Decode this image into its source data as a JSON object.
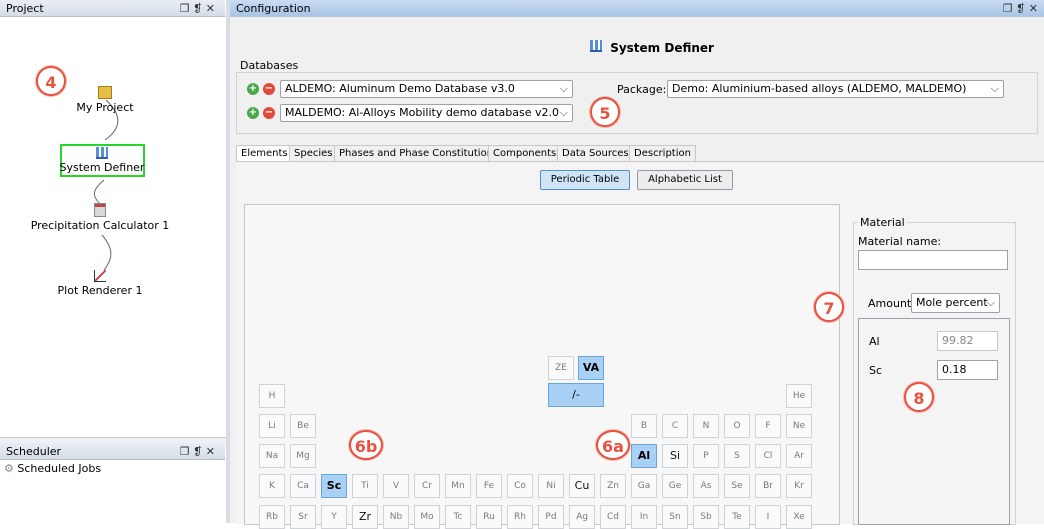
{
  "project_panel": {
    "title": "Project",
    "controls": "❐ ❡ ✕",
    "nodes": [
      {
        "label": "My Project"
      },
      {
        "label": "System Definer"
      },
      {
        "label": "Precipitation Calculator 1"
      },
      {
        "label": "Plot Renderer 1"
      }
    ],
    "badge": "4"
  },
  "scheduler_panel": {
    "title": "Scheduler",
    "controls": "❐ ❡ ✕",
    "item": "Scheduled Jobs"
  },
  "config_panel": {
    "title": "Configuration",
    "controls": "❐ ❡ ✕",
    "heading": "System Definer",
    "databases_label": "Databases",
    "databases": [
      {
        "name": "ALDEMO: Aluminum Demo Database v3.0"
      },
      {
        "name": "MALDEMO: Al-Alloys Mobility demo database v2.0"
      }
    ],
    "package_label": "Package:",
    "package_value": "Demo: Aluminium-based alloys (ALDEMO, MALDEMO)",
    "badge5": "5",
    "tabs": [
      "Elements",
      "Species",
      "Phases and Phase Constitution",
      "Components",
      "Data Sources",
      "Description"
    ],
    "view_buttons": [
      "Periodic Table",
      "Alphabetic List"
    ],
    "special": [
      "ZE",
      "VA",
      "/-"
    ],
    "badge6a": "6a",
    "badge6b": "6b",
    "material": {
      "group_label": "Material",
      "name_label": "Material name:",
      "name_value": "",
      "amount_label": "Amount",
      "amount_value": "Mole percent",
      "rows": [
        {
          "element": "Al",
          "value": "99.82"
        },
        {
          "element": "Sc",
          "value": "0.18"
        }
      ],
      "badge7": "7",
      "badge8": "8"
    },
    "elements": {
      "row1": [
        "H",
        "He"
      ],
      "row2": [
        "Li",
        "Be",
        "B",
        "C",
        "N",
        "O",
        "F",
        "Ne"
      ],
      "row3": [
        "Na",
        "Mg",
        "Al",
        "Si",
        "P",
        "S",
        "Cl",
        "Ar"
      ],
      "row4": [
        "K",
        "Ca",
        "Sc",
        "Ti",
        "V",
        "Cr",
        "Mn",
        "Fe",
        "Co",
        "Ni",
        "Cu",
        "Zn",
        "Ga",
        "Ge",
        "As",
        "Se",
        "Br",
        "Kr"
      ],
      "row5": [
        "Rb",
        "Sr",
        "Y",
        "Zr",
        "Nb",
        "Mo",
        "Tc",
        "Ru",
        "Rh",
        "Pd",
        "Ag",
        "Cd",
        "In",
        "Sn",
        "Sb",
        "Te",
        "I",
        "Xe"
      ]
    }
  },
  "colors": {
    "accent": "#e8523f",
    "selected": "#a9d0f5",
    "highlight_box": "#2bd42b"
  }
}
